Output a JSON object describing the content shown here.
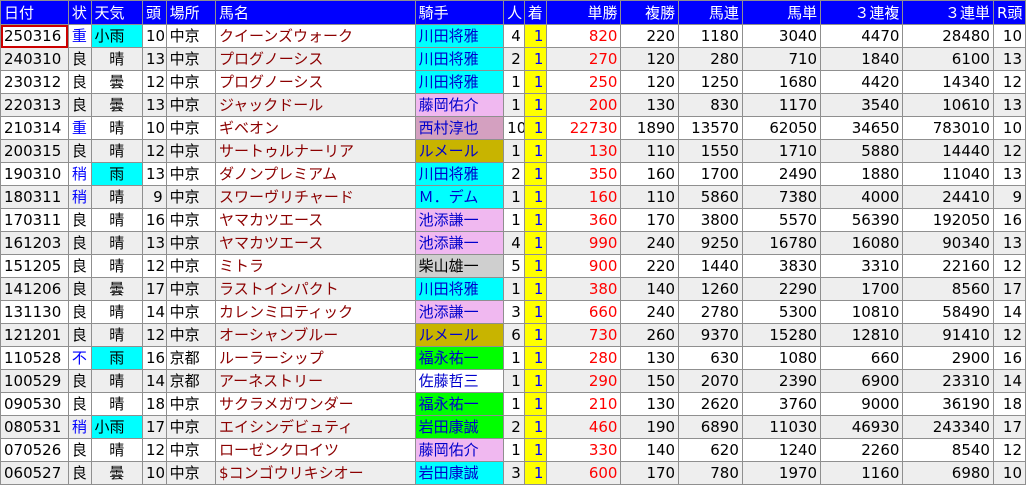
{
  "colors": {
    "header_bg": "#0000ff",
    "alt_row_bg": "#eeeeee",
    "rank_bg": "#ffff00",
    "win_color": "#ff0000",
    "horse_color": "#8b0000",
    "cond_color": "#0000ff",
    "weather_highlight_bg": "#00ffff",
    "jockey_bg": {
      "blue": "#00ffff",
      "pink": "#e8a0e8",
      "rose": "#d4a0b8",
      "olive": "#c8b400",
      "gray": "#cfcfcf",
      "green": "#00ff00",
      "white": "#ffffff"
    }
  },
  "headers": [
    "日付",
    "状",
    "天気",
    "頭",
    "場所",
    "馬名",
    "騎手",
    "人",
    "着",
    "単勝",
    "複勝",
    "馬連",
    "馬単",
    "３連複",
    "３連単",
    "R頭"
  ],
  "rows": [
    {
      "date": "250316",
      "cond": "重",
      "weather": "小雨",
      "heads": "10",
      "place": "中京",
      "horse": "クイーンズウォーク",
      "jockey": "川田将雅",
      "jockey_color": "#00ffff",
      "pop": "4",
      "rank": "1",
      "win": "820",
      "place_pay": "220",
      "umaren": "1180",
      "umatan": "3040",
      "trio": "4470",
      "trifecta": "28480",
      "rheads": "10"
    },
    {
      "date": "240310",
      "cond": "良",
      "weather": "晴",
      "heads": "13",
      "place": "中京",
      "horse": "プログノーシス",
      "jockey": "川田将雅",
      "jockey_color": "#00ffff",
      "pop": "2",
      "rank": "1",
      "win": "270",
      "place_pay": "120",
      "umaren": "280",
      "umatan": "710",
      "trio": "1840",
      "trifecta": "6100",
      "rheads": "13"
    },
    {
      "date": "230312",
      "cond": "良",
      "weather": "曇",
      "heads": "12",
      "place": "中京",
      "horse": "プログノーシス",
      "jockey": "川田将雅",
      "jockey_color": "#00ffff",
      "pop": "1",
      "rank": "1",
      "win": "250",
      "place_pay": "120",
      "umaren": "1250",
      "umatan": "1680",
      "trio": "4420",
      "trifecta": "14340",
      "rheads": "12"
    },
    {
      "date": "220313",
      "cond": "良",
      "weather": "曇",
      "heads": "13",
      "place": "中京",
      "horse": "ジャックドール",
      "jockey": "藤岡佑介",
      "jockey_color": "#f0b8f0",
      "pop": "1",
      "rank": "1",
      "win": "200",
      "place_pay": "130",
      "umaren": "830",
      "umatan": "1170",
      "trio": "3540",
      "trifecta": "10610",
      "rheads": "13"
    },
    {
      "date": "210314",
      "cond": "重",
      "weather": "晴",
      "heads": "10",
      "place": "中京",
      "horse": "ギベオン",
      "jockey": "西村淳也",
      "jockey_color": "#d4a0c0",
      "pop": "10",
      "rank": "1",
      "win": "22730",
      "place_pay": "1890",
      "umaren": "13570",
      "umatan": "62050",
      "trio": "34650",
      "trifecta": "783010",
      "rheads": "10"
    },
    {
      "date": "200315",
      "cond": "良",
      "weather": "晴",
      "heads": "12",
      "place": "中京",
      "horse": "サートゥルナーリア",
      "jockey": "ルメール",
      "jockey_color": "#c8b400",
      "pop": "1",
      "rank": "1",
      "win": "130",
      "place_pay": "110",
      "umaren": "1550",
      "umatan": "1710",
      "trio": "5880",
      "trifecta": "14440",
      "rheads": "12"
    },
    {
      "date": "190310",
      "cond": "稍",
      "weather": "雨",
      "heads": "13",
      "place": "中京",
      "horse": "ダノンプレミアム",
      "jockey": "川田将雅",
      "jockey_color": "#00ffff",
      "pop": "2",
      "rank": "1",
      "win": "350",
      "place_pay": "160",
      "umaren": "1700",
      "umatan": "2490",
      "trio": "1880",
      "trifecta": "11040",
      "rheads": "13"
    },
    {
      "date": "180311",
      "cond": "稍",
      "weather": "晴",
      "heads": "9",
      "place": "中京",
      "horse": "スワーヴリチャード",
      "jockey": "Ｍ．デム",
      "jockey_color": "#00ffff",
      "pop": "1",
      "rank": "1",
      "win": "160",
      "place_pay": "110",
      "umaren": "5860",
      "umatan": "7380",
      "trio": "4000",
      "trifecta": "24410",
      "rheads": "9"
    },
    {
      "date": "170311",
      "cond": "良",
      "weather": "晴",
      "heads": "16",
      "place": "中京",
      "horse": "ヤマカツエース",
      "jockey": "池添謙一",
      "jockey_color": "#f0b8f0",
      "pop": "1",
      "rank": "1",
      "win": "360",
      "place_pay": "170",
      "umaren": "3800",
      "umatan": "5570",
      "trio": "56390",
      "trifecta": "192050",
      "rheads": "16"
    },
    {
      "date": "161203",
      "cond": "良",
      "weather": "晴",
      "heads": "13",
      "place": "中京",
      "horse": "ヤマカツエース",
      "jockey": "池添謙一",
      "jockey_color": "#f0b8f0",
      "pop": "4",
      "rank": "1",
      "win": "990",
      "place_pay": "240",
      "umaren": "9250",
      "umatan": "16780",
      "trio": "16080",
      "trifecta": "90340",
      "rheads": "13"
    },
    {
      "date": "151205",
      "cond": "良",
      "weather": "晴",
      "heads": "12",
      "place": "中京",
      "horse": "ミトラ",
      "jockey": "柴山雄一",
      "jockey_color": "#cfcfcf",
      "pop": "5",
      "rank": "1",
      "win": "900",
      "place_pay": "220",
      "umaren": "1440",
      "umatan": "3830",
      "trio": "3310",
      "trifecta": "22160",
      "rheads": "12"
    },
    {
      "date": "141206",
      "cond": "良",
      "weather": "曇",
      "heads": "17",
      "place": "中京",
      "horse": "ラストインパクト",
      "jockey": "川田将雅",
      "jockey_color": "#00ffff",
      "pop": "1",
      "rank": "1",
      "win": "380",
      "place_pay": "140",
      "umaren": "1260",
      "umatan": "2290",
      "trio": "1700",
      "trifecta": "8560",
      "rheads": "17"
    },
    {
      "date": "131130",
      "cond": "良",
      "weather": "晴",
      "heads": "14",
      "place": "中京",
      "horse": "カレンミロティック",
      "jockey": "池添謙一",
      "jockey_color": "#f0b8f0",
      "pop": "3",
      "rank": "1",
      "win": "660",
      "place_pay": "240",
      "umaren": "2780",
      "umatan": "5300",
      "trio": "10810",
      "trifecta": "58490",
      "rheads": "14"
    },
    {
      "date": "121201",
      "cond": "良",
      "weather": "晴",
      "heads": "12",
      "place": "中京",
      "horse": "オーシャンブルー",
      "jockey": "ルメール",
      "jockey_color": "#c8b400",
      "pop": "6",
      "rank": "1",
      "win": "730",
      "place_pay": "260",
      "umaren": "9370",
      "umatan": "15280",
      "trio": "12810",
      "trifecta": "91410",
      "rheads": "12"
    },
    {
      "date": "110528",
      "cond": "不",
      "weather": "雨",
      "heads": "16",
      "place": "京都",
      "horse": "ルーラーシップ",
      "jockey": "福永祐一",
      "jockey_color": "#00ff00",
      "pop": "1",
      "rank": "1",
      "win": "280",
      "place_pay": "130",
      "umaren": "630",
      "umatan": "1080",
      "trio": "660",
      "trifecta": "2900",
      "rheads": "16"
    },
    {
      "date": "100529",
      "cond": "良",
      "weather": "晴",
      "heads": "14",
      "place": "京都",
      "horse": "アーネストリー",
      "jockey": "佐藤哲三",
      "jockey_color": "#ffffff",
      "pop": "1",
      "rank": "1",
      "win": "290",
      "place_pay": "150",
      "umaren": "2070",
      "umatan": "2390",
      "trio": "6900",
      "trifecta": "23310",
      "rheads": "14"
    },
    {
      "date": "090530",
      "cond": "良",
      "weather": "晴",
      "heads": "18",
      "place": "中京",
      "horse": "サクラメガワンダー",
      "jockey": "福永祐一",
      "jockey_color": "#00ff00",
      "pop": "1",
      "rank": "1",
      "win": "210",
      "place_pay": "130",
      "umaren": "2620",
      "umatan": "3760",
      "trio": "9000",
      "trifecta": "36190",
      "rheads": "18"
    },
    {
      "date": "080531",
      "cond": "稍",
      "weather": "小雨",
      "heads": "17",
      "place": "中京",
      "horse": "エイシンデビュティ",
      "jockey": "岩田康誠",
      "jockey_color": "#00ff00",
      "pop": "2",
      "rank": "1",
      "win": "460",
      "place_pay": "190",
      "umaren": "6890",
      "umatan": "11030",
      "trio": "46930",
      "trifecta": "243340",
      "rheads": "17"
    },
    {
      "date": "070526",
      "cond": "良",
      "weather": "晴",
      "heads": "12",
      "place": "中京",
      "horse": "ローゼンクロイツ",
      "jockey": "藤岡佑介",
      "jockey_color": "#f0b8f0",
      "pop": "1",
      "rank": "1",
      "win": "330",
      "place_pay": "140",
      "umaren": "620",
      "umatan": "1240",
      "trio": "2260",
      "trifecta": "8540",
      "rheads": "12"
    },
    {
      "date": "060527",
      "cond": "良",
      "weather": "曇",
      "heads": "10",
      "place": "中京",
      "horse": "$コンゴウリキシオー",
      "jockey": "岩田康誠",
      "jockey_color": "#00ffff",
      "pop": "3",
      "rank": "1",
      "win": "600",
      "place_pay": "170",
      "umaren": "780",
      "umatan": "1970",
      "trio": "1160",
      "trifecta": "6980",
      "rheads": "10"
    }
  ]
}
